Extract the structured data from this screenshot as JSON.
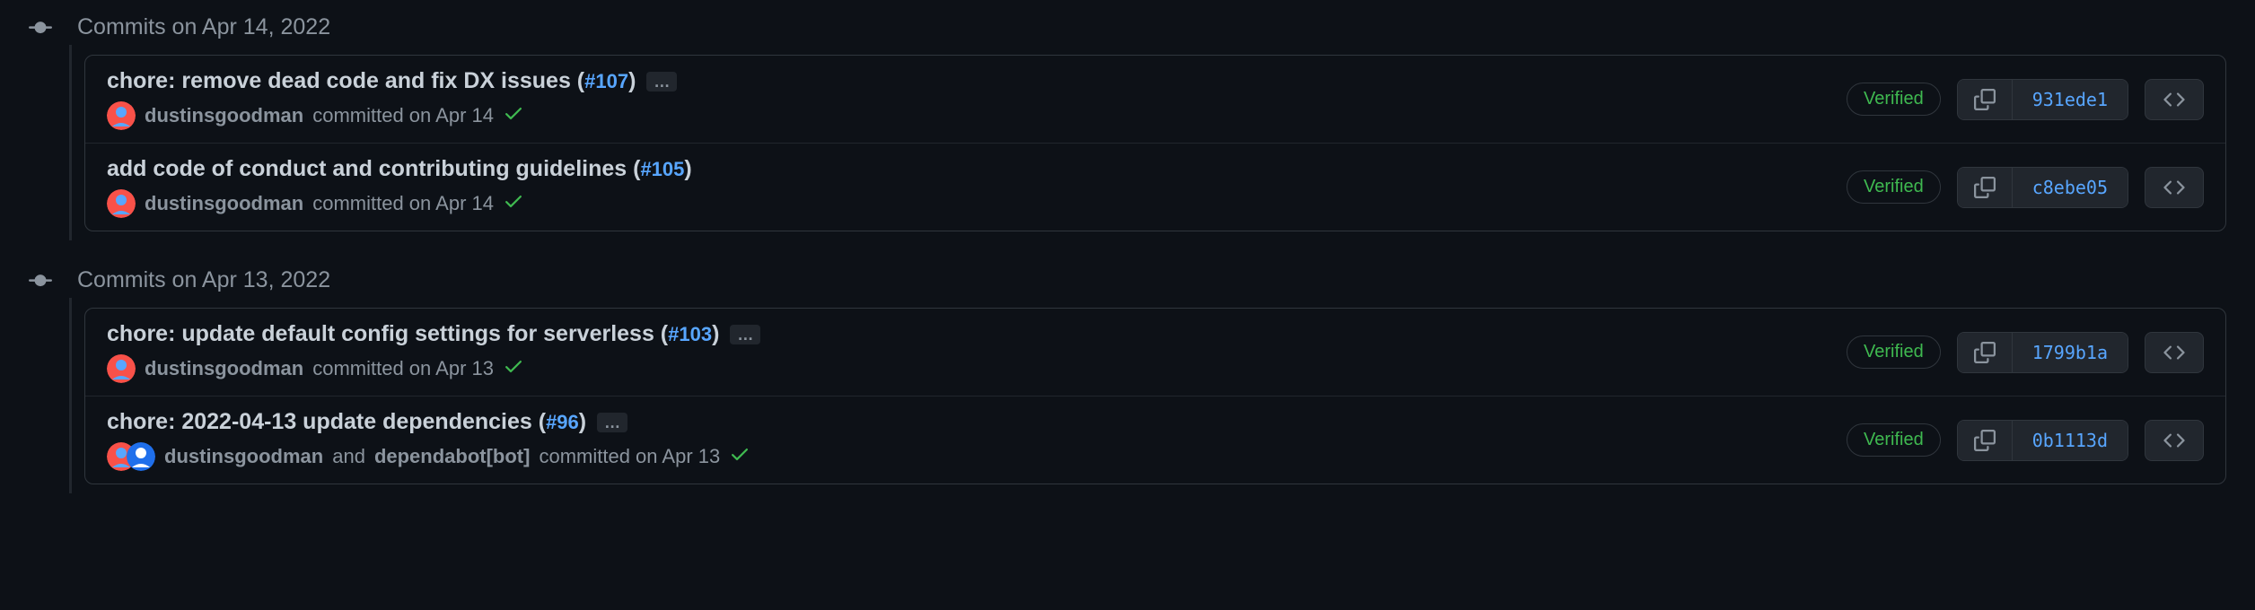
{
  "groups": [
    {
      "date_label": "Commits on Apr 14, 2022",
      "commits": [
        {
          "title_prefix": "chore: remove dead code and fix DX issues (",
          "pr_number": "#107",
          "title_suffix": ")",
          "show_expand": true,
          "expand_label": "…",
          "authors": [
            {
              "name": "dustinsgoodman",
              "avatar_color1": "#f85149",
              "avatar_color2": "#58a6ff"
            }
          ],
          "and_text": "",
          "second_author": "",
          "meta_text": "committed on Apr 14",
          "verified": "Verified",
          "sha": "931ede1"
        },
        {
          "title_prefix": "add code of conduct and contributing guidelines (",
          "pr_number": "#105",
          "title_suffix": ")",
          "show_expand": false,
          "expand_label": "",
          "authors": [
            {
              "name": "dustinsgoodman",
              "avatar_color1": "#f85149",
              "avatar_color2": "#58a6ff"
            }
          ],
          "and_text": "",
          "second_author": "",
          "meta_text": "committed on Apr 14",
          "verified": "Verified",
          "sha": "c8ebe05"
        }
      ]
    },
    {
      "date_label": "Commits on Apr 13, 2022",
      "commits": [
        {
          "title_prefix": "chore: update default config settings for serverless (",
          "pr_number": "#103",
          "title_suffix": ")",
          "show_expand": true,
          "expand_label": "…",
          "authors": [
            {
              "name": "dustinsgoodman",
              "avatar_color1": "#f85149",
              "avatar_color2": "#58a6ff"
            }
          ],
          "and_text": "",
          "second_author": "",
          "meta_text": "committed on Apr 13",
          "verified": "Verified",
          "sha": "1799b1a"
        },
        {
          "title_prefix": "chore: 2022-04-13 update dependencies (",
          "pr_number": "#96",
          "title_suffix": ")",
          "show_expand": true,
          "expand_label": "…",
          "authors": [
            {
              "name": "dustinsgoodman",
              "avatar_color1": "#f85149",
              "avatar_color2": "#58a6ff"
            },
            {
              "name": "dependabot[bot]",
              "avatar_color1": "#1f6feb",
              "avatar_color2": "#ffffff"
            }
          ],
          "and_text": " and ",
          "second_author": "dependabot[bot]",
          "meta_text": "committed on Apr 13",
          "verified": "Verified",
          "sha": "0b1113d"
        }
      ]
    }
  ]
}
